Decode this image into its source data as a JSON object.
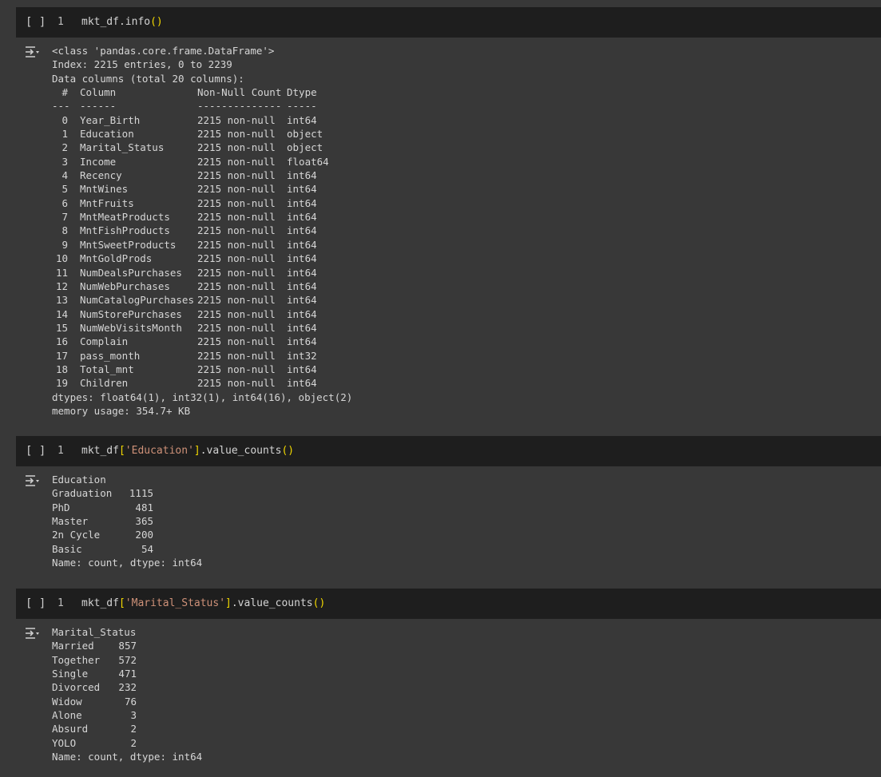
{
  "cells": [
    {
      "run_label": "[ ]",
      "line_number": "1",
      "code": {
        "prefix": "mkt_df.info",
        "open": "(",
        "arg": "",
        "close": ")",
        "suffix": ""
      },
      "output": {
        "header_lines": [
          "<class 'pandas.core.frame.DataFrame'>",
          "Index: 2215 entries, 0 to 2239",
          "Data columns (total 20 columns):"
        ],
        "table_header": {
          "num": "#",
          "column": "Column",
          "count": "Non-Null Count",
          "dtype": "Dtype"
        },
        "table_rule": {
          "num": "---",
          "column": "------",
          "count": "--------------",
          "dtype": "-----"
        },
        "rows": [
          {
            "num": "0",
            "column": "Year_Birth",
            "count": "2215 non-null",
            "dtype": "int64"
          },
          {
            "num": "1",
            "column": "Education",
            "count": "2215 non-null",
            "dtype": "object"
          },
          {
            "num": "2",
            "column": "Marital_Status",
            "count": "2215 non-null",
            "dtype": "object"
          },
          {
            "num": "3",
            "column": "Income",
            "count": "2215 non-null",
            "dtype": "float64"
          },
          {
            "num": "4",
            "column": "Recency",
            "count": "2215 non-null",
            "dtype": "int64"
          },
          {
            "num": "5",
            "column": "MntWines",
            "count": "2215 non-null",
            "dtype": "int64"
          },
          {
            "num": "6",
            "column": "MntFruits",
            "count": "2215 non-null",
            "dtype": "int64"
          },
          {
            "num": "7",
            "column": "MntMeatProducts",
            "count": "2215 non-null",
            "dtype": "int64"
          },
          {
            "num": "8",
            "column": "MntFishProducts",
            "count": "2215 non-null",
            "dtype": "int64"
          },
          {
            "num": "9",
            "column": "MntSweetProducts",
            "count": "2215 non-null",
            "dtype": "int64"
          },
          {
            "num": "10",
            "column": "MntGoldProds",
            "count": "2215 non-null",
            "dtype": "int64"
          },
          {
            "num": "11",
            "column": "NumDealsPurchases",
            "count": "2215 non-null",
            "dtype": "int64"
          },
          {
            "num": "12",
            "column": "NumWebPurchases",
            "count": "2215 non-null",
            "dtype": "int64"
          },
          {
            "num": "13",
            "column": "NumCatalogPurchases",
            "count": "2215 non-null",
            "dtype": "int64"
          },
          {
            "num": "14",
            "column": "NumStorePurchases",
            "count": "2215 non-null",
            "dtype": "int64"
          },
          {
            "num": "15",
            "column": "NumWebVisitsMonth",
            "count": "2215 non-null",
            "dtype": "int64"
          },
          {
            "num": "16",
            "column": "Complain",
            "count": "2215 non-null",
            "dtype": "int64"
          },
          {
            "num": "17",
            "column": "pass_month",
            "count": "2215 non-null",
            "dtype": "int32"
          },
          {
            "num": "18",
            "column": "Total_mnt",
            "count": "2215 non-null",
            "dtype": "int64"
          },
          {
            "num": "19",
            "column": "Children",
            "count": "2215 non-null",
            "dtype": "int64"
          }
        ],
        "footer_lines": [
          "dtypes: float64(1), int32(1), int64(16), object(2)",
          "memory usage: 354.7+ KB"
        ]
      }
    },
    {
      "run_label": "[ ]",
      "line_number": "1",
      "code": {
        "prefix": "mkt_df",
        "open": "[",
        "arg": "'Education'",
        "close": "]",
        "suffix": ".value_counts",
        "call_open": "(",
        "call_close": ")"
      },
      "output": {
        "title": "Education",
        "rows": [
          {
            "label": "Graduation",
            "value": "1115"
          },
          {
            "label": "PhD",
            "value": "481"
          },
          {
            "label": "Master",
            "value": "365"
          },
          {
            "label": "2n Cycle",
            "value": "200"
          },
          {
            "label": "Basic",
            "value": "54"
          }
        ],
        "footer": "Name: count, dtype: int64"
      }
    },
    {
      "run_label": "[ ]",
      "line_number": "1",
      "code": {
        "prefix": "mkt_df",
        "open": "[",
        "arg": "'Marital_Status'",
        "close": "]",
        "suffix": ".value_counts",
        "call_open": "(",
        "call_close": ")"
      },
      "output": {
        "title": "Marital_Status",
        "rows": [
          {
            "label": "Married",
            "value": "857"
          },
          {
            "label": "Together",
            "value": "572"
          },
          {
            "label": "Single",
            "value": "471"
          },
          {
            "label": "Divorced",
            "value": "232"
          },
          {
            "label": "Widow",
            "value": "76"
          },
          {
            "label": "Alone",
            "value": "3"
          },
          {
            "label": "Absurd",
            "value": "2"
          },
          {
            "label": "YOLO",
            "value": "2"
          }
        ],
        "footer": "Name: count, dtype: int64"
      }
    }
  ],
  "colors": {
    "background": "#383838",
    "code_background": "#1e1e1e",
    "paren": "#f1d700",
    "string": "#ce9178",
    "text": "#d6d6d6"
  },
  "icons": {
    "output_toggle": "output-toggle-icon"
  }
}
